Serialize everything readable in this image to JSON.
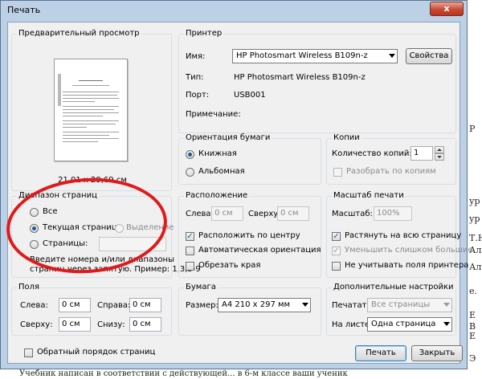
{
  "dialog": {
    "title": "Печать",
    "close_label": "x"
  },
  "preview": {
    "group_title": "Предварительный просмотр",
    "size_label": "21,01 x 29,69 см"
  },
  "printer": {
    "group_title": "Принтер",
    "name_label": "Имя:",
    "name_value": "HP Photosmart Wireless B109n-z",
    "properties_button": "Свойства",
    "type_label": "Тип:",
    "type_value": "HP Photosmart Wireless B109n-z",
    "port_label": "Порт:",
    "port_value": "USB001",
    "note_label": "Примечание:"
  },
  "orientation": {
    "group_title": "Ориентация бумаги",
    "portrait": "Книжная",
    "landscape": "Альбомная",
    "selected": "portrait"
  },
  "copies": {
    "group_title": "Копии",
    "count_label": "Количество копий:",
    "count_value": "1",
    "collate_label": "Разобрать по копиям"
  },
  "page_range": {
    "group_title": "Диапазон страниц",
    "all": "Все",
    "current": "Текущая страница",
    "selection": "Выделение",
    "pages": "Страницы:",
    "hint_line1": "Введите номера и/или диапазоны",
    "hint_line2": "страниц через запятую. Пример: 1,3,5-9",
    "selected": "current"
  },
  "position": {
    "group_title": "Расположение",
    "left_label": "Слева:",
    "left_value": "0 см",
    "top_label": "Сверху:",
    "top_value": "0 см",
    "center_label": "Расположить по центру",
    "auto_orient_label": "Автоматическая ориентация",
    "crop_label": "Обрезать края"
  },
  "scale": {
    "group_title": "Масштаб печати",
    "scale_label": "Масштаб:",
    "scale_value": "100%",
    "fit_label": "Растянуть на всю страницу",
    "shrink_label": "Уменьшить слишком большие",
    "ignore_margins_label": "Не учитывать поля принтера"
  },
  "margins": {
    "group_title": "Поля",
    "left_label": "Слева:",
    "left_value": "0 см",
    "right_label": "Справа:",
    "right_value": "0 см",
    "top_label": "Сверху:",
    "top_value": "0 см",
    "bottom_label": "Снизу:",
    "bottom_value": "0 см"
  },
  "paper": {
    "group_title": "Бумага",
    "size_label": "Размер:",
    "size_value": "А4 210 x 297 мм"
  },
  "advanced": {
    "group_title": "Дополнительные настройки",
    "print_label": "Печатать:",
    "print_value": "Все страницы",
    "sheet_label": "На листе:",
    "sheet_value": "Одна страница"
  },
  "footer": {
    "reverse_label": "Обратный порядок страниц",
    "print_button": "Печать",
    "close_button": "Закрыть"
  },
  "background_doc": {
    "right_lines": [
      "Р",
      "ур",
      "ур",
      "Т.Н",
      "Аль",
      "Ал",
      "е.",
      "Е",
      "В",
      "Е",
      "Э"
    ],
    "bottom_text": "Учебник написан в соответствии с действующей...   в 6-м классе ваши ученик"
  },
  "colors": {
    "annotation_circle": "#e0191b",
    "title_bar": "#bcd0e6",
    "close_button": "#c74a33"
  }
}
